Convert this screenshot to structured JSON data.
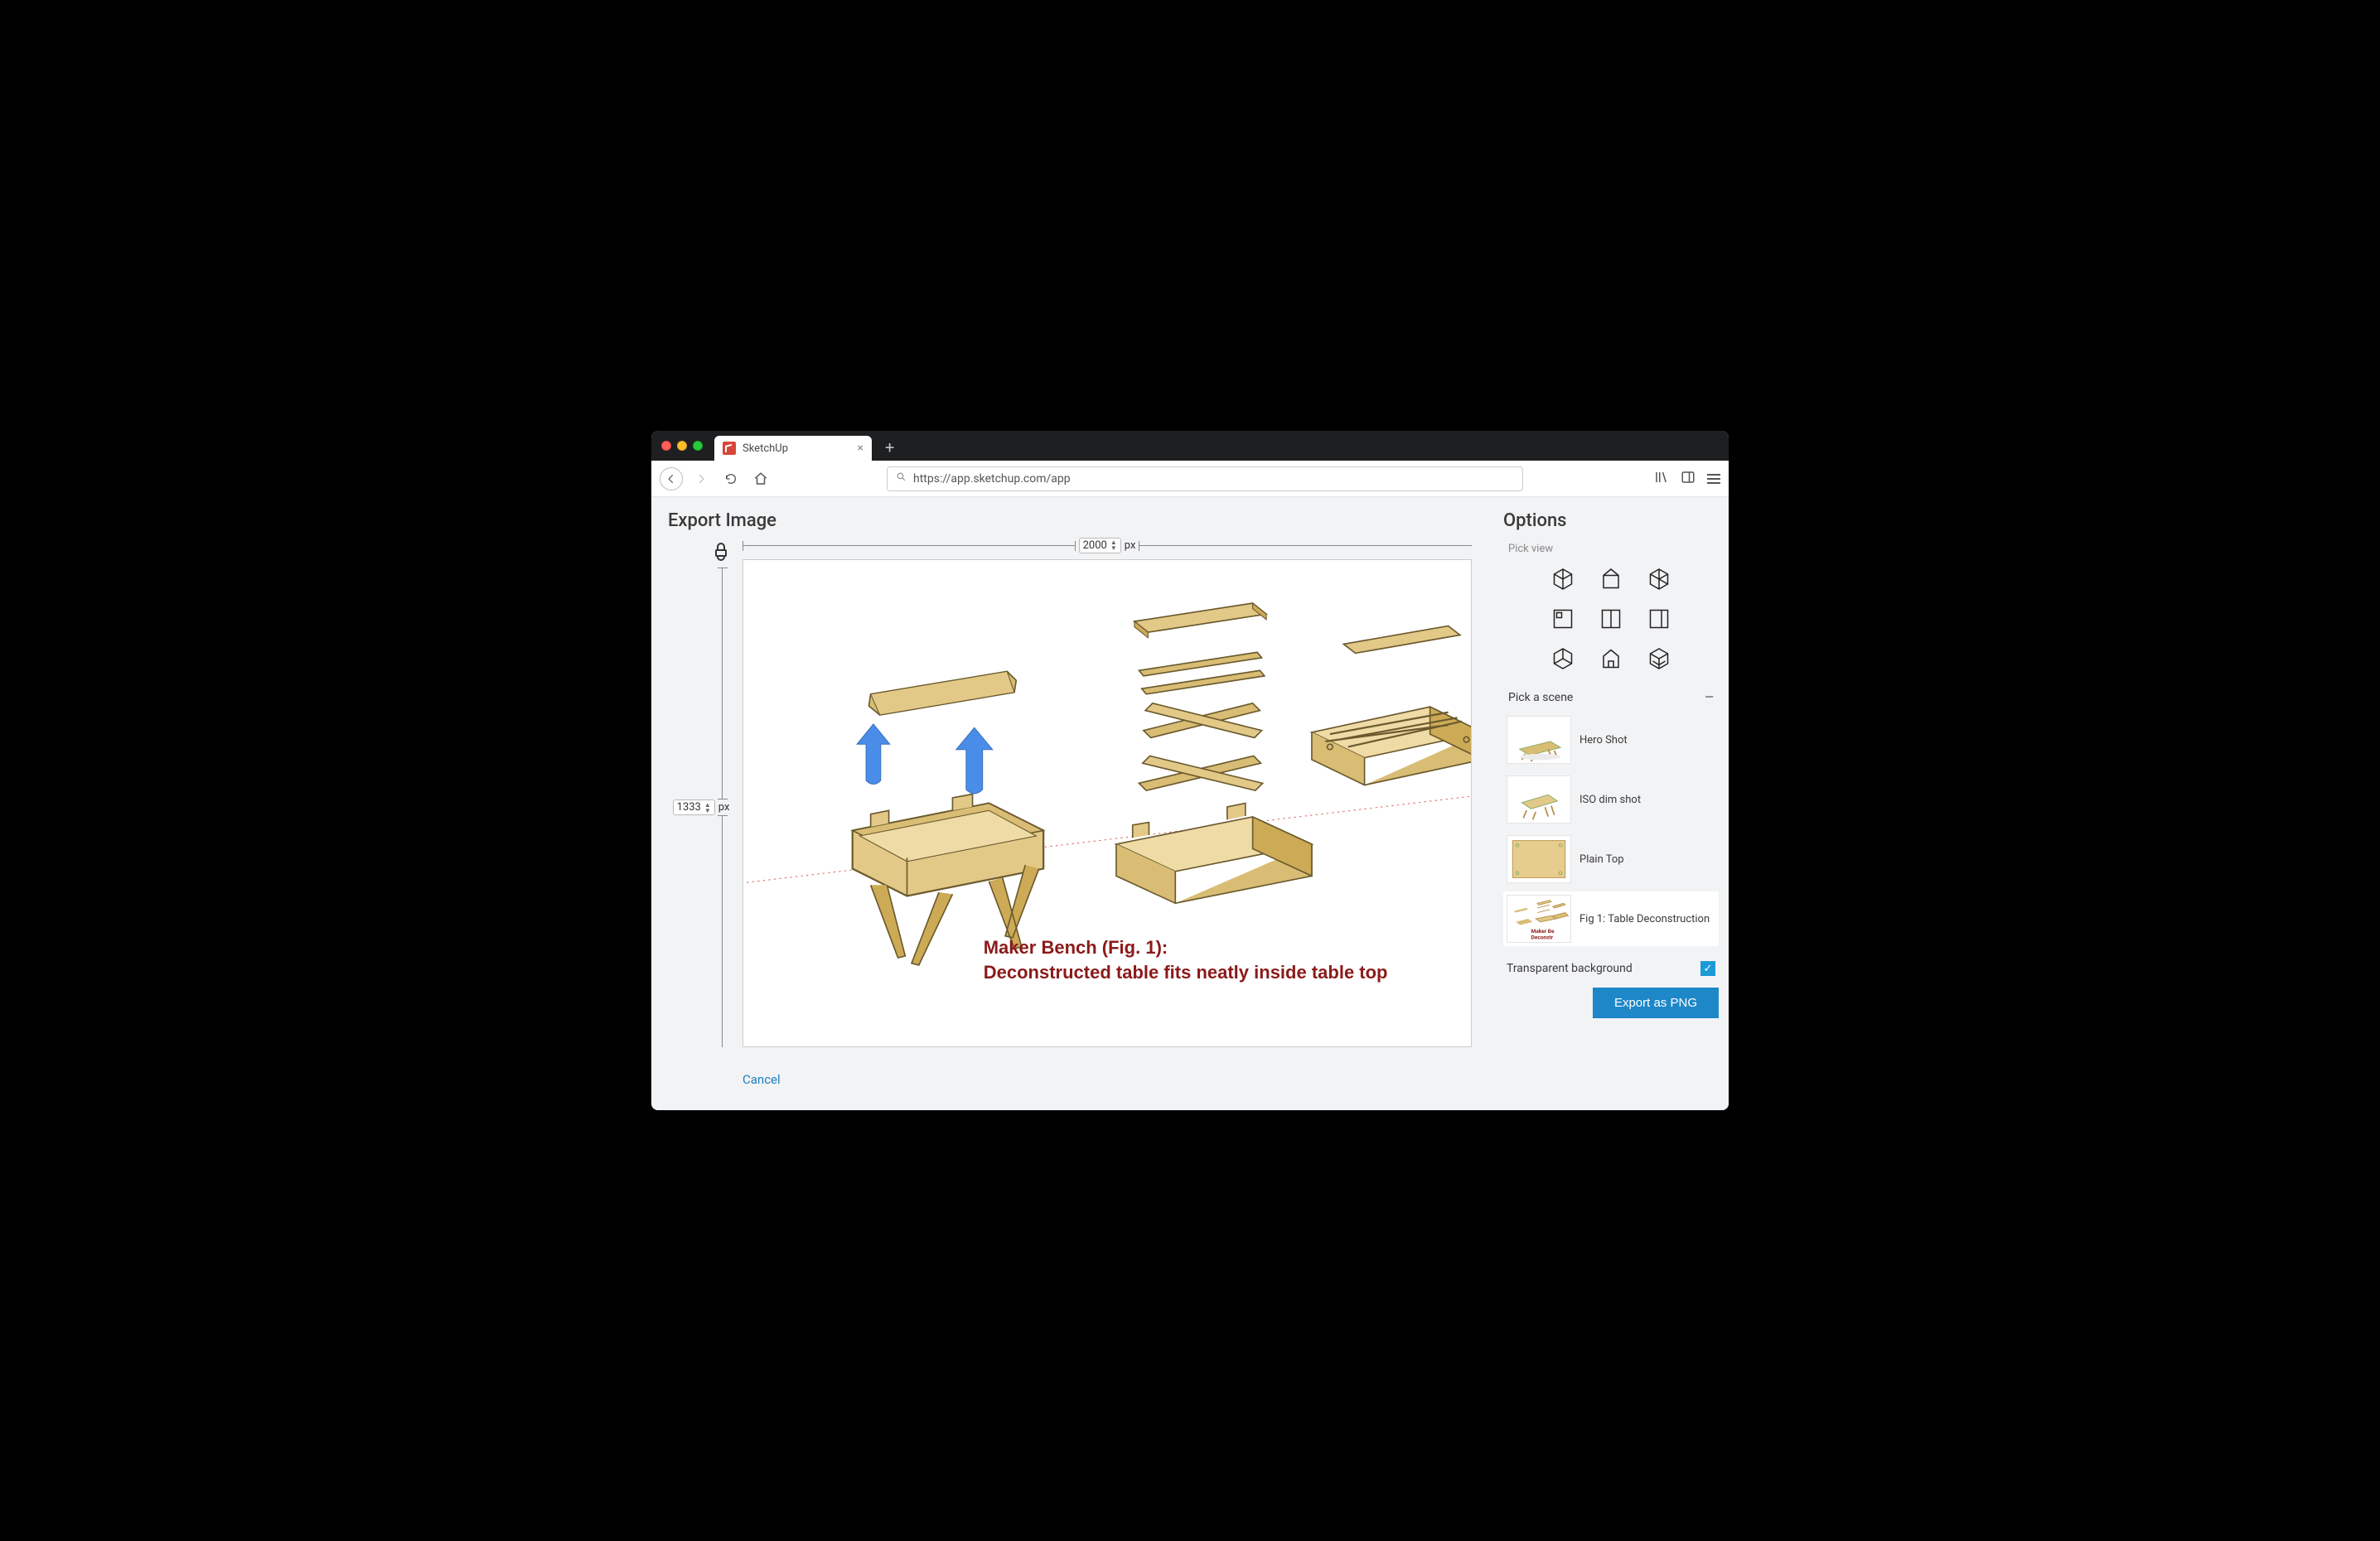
{
  "browser": {
    "tab_title": "SketchUp",
    "url": "https://app.sketchup.com/app"
  },
  "page": {
    "title": "Export Image",
    "width_value": "2000",
    "height_value": "1333",
    "unit": "px",
    "cancel": "Cancel"
  },
  "canvas": {
    "caption_line1": "Maker Bench (Fig. 1):",
    "caption_line2": "Deconstructed table fits neatly inside table top"
  },
  "options": {
    "title": "Options",
    "pick_view_label": "Pick view",
    "views": [
      "iso-view",
      "front-view",
      "right-view",
      "top-view",
      "back-view",
      "left-view",
      "bottom-view",
      "home-view",
      "perspective-view"
    ],
    "pick_scene_label": "Pick a scene",
    "scenes": [
      {
        "name": "Hero Shot"
      },
      {
        "name": "ISO dim shot"
      },
      {
        "name": "Plain Top"
      },
      {
        "name": "Fig 1: Table Deconstruction"
      }
    ],
    "selected_scene_index": 3,
    "transparent_label": "Transparent background",
    "transparent_checked": true,
    "export_button": "Export as PNG"
  }
}
